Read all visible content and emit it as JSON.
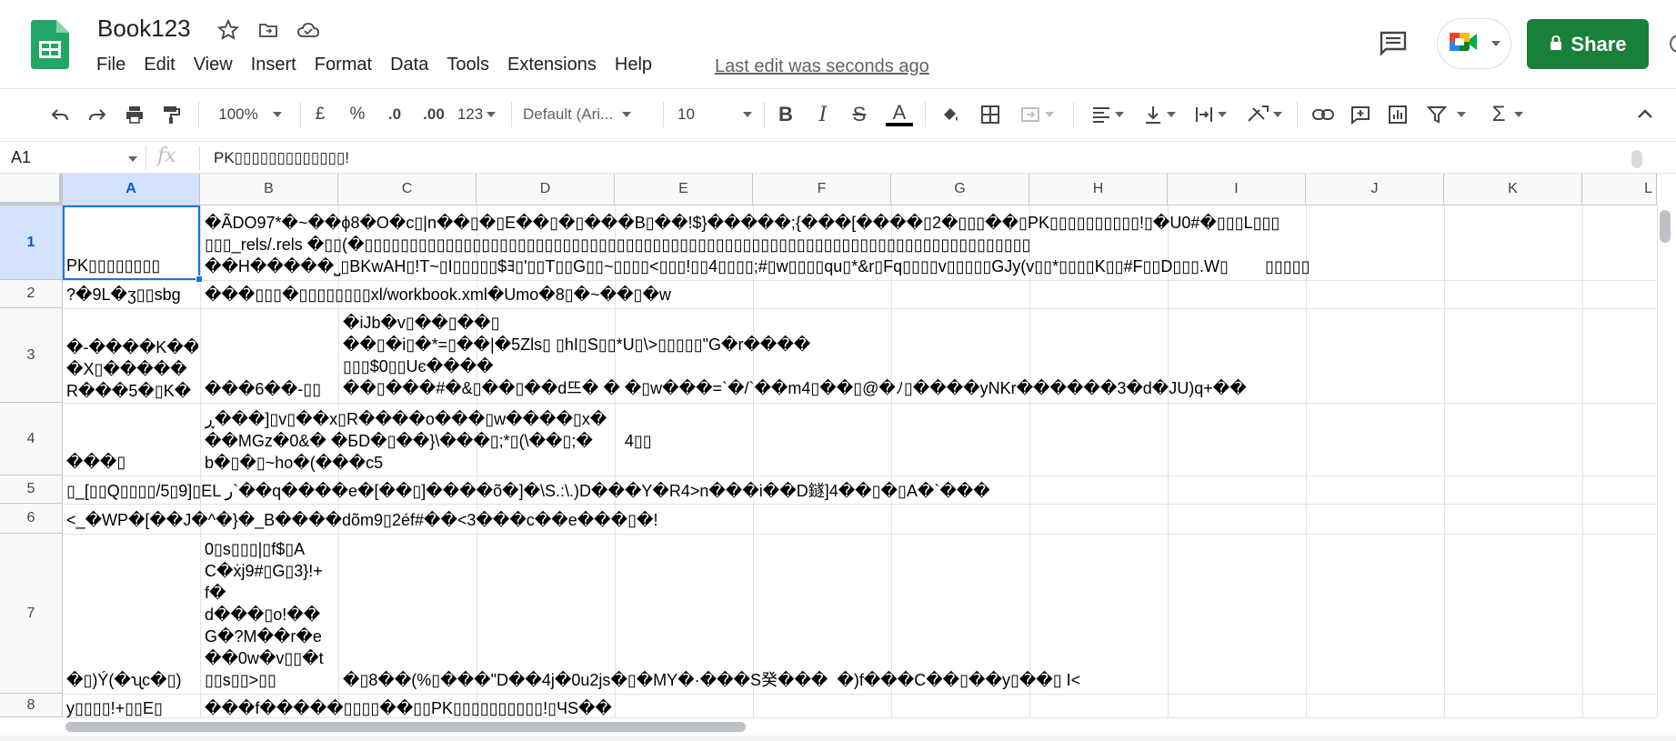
{
  "doc": {
    "title": "Book123",
    "last_edit": "Last edit was seconds ago",
    "share_label": "Share"
  },
  "menu": [
    "File",
    "Edit",
    "View",
    "Insert",
    "Format",
    "Data",
    "Tools",
    "Extensions",
    "Help"
  ],
  "toolbar": {
    "zoom": "100%",
    "currency": "£",
    "percent": "%",
    "dec_decrease": ".0",
    "dec_increase": ".00",
    "more_formats": "123",
    "font": "Default (Ari...",
    "font_size": "10"
  },
  "formula_bar": {
    "cell_ref": "A1",
    "fx": "fx",
    "content": "PK▯▯▯▯▯▯▯▯▯▯▯▯▯!"
  },
  "columns": [
    "A",
    "B",
    "C",
    "D",
    "E",
    "F",
    "G",
    "H",
    "I",
    "J",
    "K",
    "L"
  ],
  "rows": [
    "1",
    "2",
    "3",
    "4",
    "5",
    "6",
    "7",
    "8"
  ],
  "cells": {
    "r1_a": "PK▯▯▯▯▯▯▯▯",
    "r1_b": "�ÃDO97*�~��ϕ8�O�c▯|n��▯�▯E��▯�▯���B▯��!$}�����;{���[����▯2�▯▯▯��▯PK▯▯▯▯▯▯▯▯▯▯!▯�U0#�▯▯▯L▯▯▯\n▯▯▯_rels/.rels �▯▯(�▯▯▯▯▯▯▯▯▯▯▯▯▯▯▯▯▯▯▯▯▯▯▯▯▯▯▯▯▯▯▯▯▯▯▯▯▯▯▯▯▯▯▯▯▯▯▯▯▯▯▯▯▯▯▯▯▯▯▯▯▯▯▯▯▯▯▯▯▯▯▯▯▯▯\n��H�����⎵▯BKwAH▯!T~▯I▯▯▯▯▯$ﾖ▯'▯▯T▯▯G▯▯~▯▯▯▯<▯▯▯!▯▯4▯▯▯▯;#▯w▯▯▯▯qu▯*&r▯Fq▯▯▯▯v▯▯▯▯▯GJy(v▯▯*▯▯▯▯K▯▯#F▯▯D▯▯▯.W▯        ▯▯▯▯▯",
    "r2_a": "?�9L�ʒ▯▯sbg",
    "r2_b": "���▯▯▯�▯▯▯▯▯▯▯▯xl/workbook.xml�Umo�8▯�~��▯�w",
    "r3_a": "�-����K��\n�X▯�����\nR���5�▯K�",
    "r3_b": "���6��-▯▯",
    "r3_c": "�iJb�v▯��▯��▯\n��▯�i▯�*=▯��|�5Zls▯ ▯hI▯S▯▯*U▯\\>▯▯▯▯▯\"G�r����\n▯▯▯$0▯▯Uє����\n��▯���#�&▯��▯��d뜨� � �▯w���=`�/`��m4▯��▯@�ﾉ▯����yNKr������3�d�JU)q+��",
    "r4_a": "���▯",
    "r4_b": "ڕ���]▯v▯��x▯R����o���▯w����▯x�\n��MGz�0&� �БD�▯��}\\���▯;*▯(\\��▯;�       4▯▯\nb�▯�▯~ho�(���c5",
    "r5_a": "▯_[▯▯Q▯▯▯▯/5▯9]▯EL ر`��q����e�[��▯]����õ�]�\\S.:\\.)D���Y�R4>n���i��D鐩]4��▯�▯A�`���",
    "r6_a": "<_�WP�[��J�^�}�_B����dõm9▯2éf#��<3���c��e���▯�!",
    "r7_a": "�▯)Ý(�ʯc�▯)",
    "r7_b": "0▯s▯▯▯|▯f$▯A\nC�ẋj9#▯G▯3}!+\nf�\nd���▯o!��\nG�?M��r�e\n��0w�v▯▯�t\n▯▯s▯▯>▯▯",
    "r7_c": "�▯8��(%▯���\"D��4j�0u2js�▯�MY�·���S癸���  �)f���C��▯��y▯��▯ I<",
    "r8_a": "y▯▯▯▯!+▯▯E▯",
    "r8_b": "���f�����▯▯▯▯��▯▯PK▯▯▯▯▯▯▯▯▯▯!▯ЧS��"
  },
  "colors": {
    "share_green": "#188038",
    "selection_blue": "#1a73e8",
    "sheets_green": "#23a566"
  },
  "icons": [
    "sheets-logo-icon",
    "star-icon",
    "move-icon",
    "cloud-status-icon",
    "comments-icon",
    "meet-icon",
    "lock-icon",
    "undo-icon",
    "redo-icon",
    "print-icon",
    "paint-format-icon",
    "bold-icon",
    "italic-icon",
    "strikethrough-icon",
    "text-color-icon",
    "fill-color-icon",
    "borders-icon",
    "merge-cells-icon",
    "align-left-icon",
    "valign-bottom-icon",
    "text-wrap-icon",
    "text-rotate-icon",
    "link-icon",
    "comment-icon",
    "chart-icon",
    "filter-icon",
    "functions-icon",
    "collapse-icon"
  ]
}
